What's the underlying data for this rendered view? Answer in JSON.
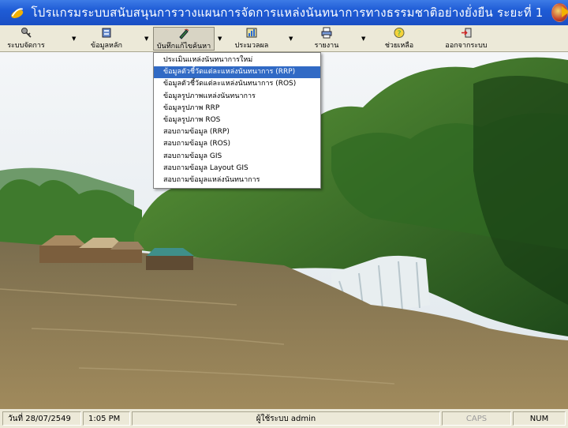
{
  "window": {
    "title": "โปรแกรมระบบสนับสนุนการวางแผนการจัดการแหล่งนันทนาการทางธรรมชาติอย่างยั่งยืน ระยะที่ 1"
  },
  "toolbar": {
    "items": [
      {
        "label": "ระบบจัดการ",
        "icon": "key-icon"
      },
      {
        "label": "ข้อมูลหลัก",
        "icon": "database-icon"
      },
      {
        "label": "บันทึกแก้ไขค้นหา",
        "icon": "pencil-icon"
      },
      {
        "label": "ประมวลผล",
        "icon": "chart-icon"
      },
      {
        "label": "รายงาน",
        "icon": "printer-icon"
      },
      {
        "label": "ช่วยเหลือ",
        "icon": "help-icon"
      },
      {
        "label": "ออกจากระบบ",
        "icon": "exit-icon"
      }
    ]
  },
  "menu": {
    "items": [
      "ประเมินแหล่งนันทนาการใหม่",
      "ข้อมูลตัวชี้วัดแต่ละแหล่งนันทนาการ (RRP)",
      "ข้อมูลตัวชี้วัดแต่ละแหล่งนันทนาการ (ROS)",
      "ข้อมูลรูปภาพแหล่งนันทนาการ",
      "ข้อมูลรูปภาพ RRP",
      "ข้อมูลรูปภาพ ROS",
      "สอบถามข้อมูล (RRP)",
      "สอบถามข้อมูล (ROS)",
      "สอบถามข้อมูล GIS",
      "สอบถามข้อมูล Layout GIS",
      "สอบถามข้อมูลแหล่งนันทนาการ"
    ],
    "selected_index": 1
  },
  "status": {
    "date": "วันที่ 28/07/2549",
    "time": "1:05 PM",
    "user": "ผู้ใช้ระบบ admin",
    "caps": "CAPS",
    "num": "NUM"
  },
  "colors": {
    "titlebar": "#1f5cd6",
    "menu_highlight": "#316ac5",
    "toolbar_bg": "#ece9d8"
  }
}
